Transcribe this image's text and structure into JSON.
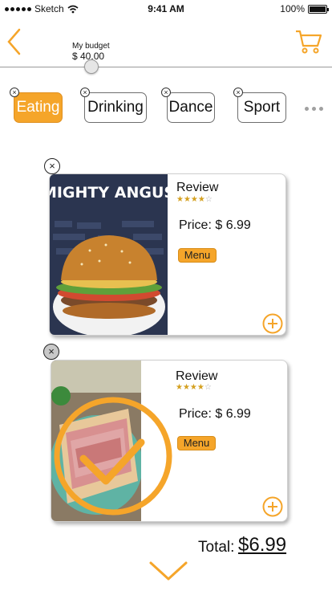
{
  "status": {
    "carrier": "Sketch",
    "time": "9:41 AM",
    "battery": "100%"
  },
  "nav": {
    "back_icon": "chevron-left-icon",
    "cart_icon": "cart-icon"
  },
  "budget": {
    "label": "My budget",
    "value": "$ 40.00",
    "slider_level": 0.24
  },
  "categories": [
    {
      "label": "Eating",
      "active": true
    },
    {
      "label": "Drinking",
      "active": false
    },
    {
      "label": "Dance",
      "active": false
    },
    {
      "label": "Sport",
      "active": false
    }
  ],
  "items": [
    {
      "review_label": "Review",
      "rating": 4,
      "rating_max": 5,
      "price": "Price: $ 6.99",
      "menu_label": "Menu",
      "image_text": "MIGHTY ANGUS",
      "selected": false
    },
    {
      "review_label": "Review",
      "rating": 4,
      "rating_max": 5,
      "price": "Price: $ 6.99",
      "menu_label": "Menu",
      "selected": true
    }
  ],
  "total": {
    "label": "Total:",
    "value": "$6.99"
  },
  "colors": {
    "accent": "#f5a52a",
    "accent_dark": "#e09020"
  }
}
